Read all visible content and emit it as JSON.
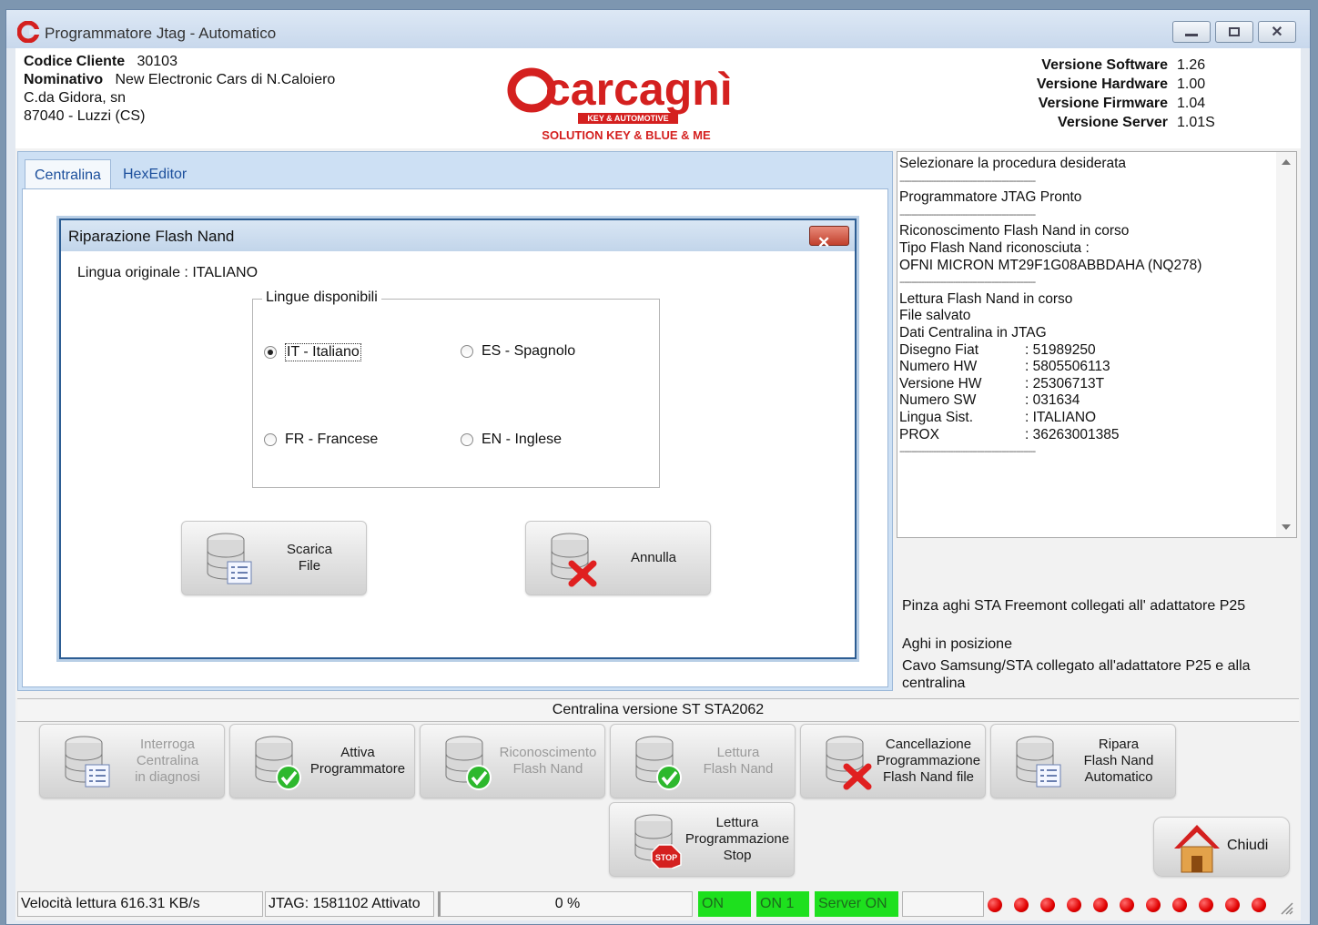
{
  "window": {
    "title": "Programmatore Jtag - Automatico"
  },
  "header": {
    "client_code_label": "Codice Cliente",
    "client_code": "30103",
    "name_label": "Nominativo",
    "name": "New Electronic Cars di N.Caloiero",
    "address1": "C.da Gidora, sn",
    "address2": "87040 - Luzzi (CS)",
    "logo_text": "carcagnì",
    "logo_tag": "KEY & AUTOMOTIVE",
    "logo_sub": "SOLUTION KEY & BLUE & ME",
    "versions": [
      {
        "label": "Versione Software",
        "value": "1.26"
      },
      {
        "label": "Versione Hardware",
        "value": "1.00"
      },
      {
        "label": "Versione Firmware",
        "value": "1.04"
      },
      {
        "label": "Versione Server",
        "value": "1.01S"
      }
    ]
  },
  "tabs": [
    {
      "label": "Centralina",
      "active": true
    },
    {
      "label": "HexEditor",
      "active": false
    }
  ],
  "dialog": {
    "title": "Riparazione Flash Nand",
    "close_label": "✕",
    "original_language": "Lingua originale : ITALIANO",
    "group_title": "Lingue disponibili",
    "options": [
      {
        "label": "IT - Italiano",
        "selected": true
      },
      {
        "label": "ES - Spagnolo",
        "selected": false
      },
      {
        "label": "FR - Francese",
        "selected": false
      },
      {
        "label": "EN - Inglese",
        "selected": false
      }
    ],
    "download_button": "Scarica\nFile",
    "cancel_button": "Annulla"
  },
  "log": {
    "lines": [
      {
        "text": "Selezionare la procedura desiderata"
      },
      {
        "sep": true
      },
      {
        "text": "Programmatore JTAG Pronto"
      },
      {
        "sep": true
      },
      {
        "text": "Riconoscimento Flash Nand in corso"
      },
      {
        "text": "Tipo Flash Nand riconosciuta :"
      },
      {
        "text": "OFNI MICRON MT29F1G08ABBDAHA (NQ278)"
      },
      {
        "sep": true
      },
      {
        "text": "Lettura Flash Nand in corso"
      },
      {
        "text": "File salvato"
      },
      {
        "text": "Dati Centralina in JTAG"
      },
      {
        "key": "Disegno Fiat",
        "val": ": 51989250"
      },
      {
        "key": "Numero HW",
        "val": ": 5805506113"
      },
      {
        "key": "Versione HW",
        "val": ": 25306713T"
      },
      {
        "key": "Numero SW",
        "val": ": 031634"
      },
      {
        "key": "Lingua Sist.",
        "val": ": ITALIANO"
      },
      {
        "key": "PROX",
        "val": ": 36263001385"
      },
      {
        "sep": true
      }
    ],
    "separator": "--------------------------------------------------------"
  },
  "messages": {
    "m1": "Pinza aghi STA Freemont collegati all' adattatore P25",
    "m2": "Aghi in posizione",
    "m3": "Cavo Samsung/STA collegato all'adattatore P25 e alla centralina"
  },
  "status_version": "Centralina versione ST STA2062",
  "actions": [
    {
      "label": "Interroga\nCentralina\nin diagnosi",
      "icon": "database-list-icon",
      "enabled": false
    },
    {
      "label": "Attiva\nProgrammatore",
      "icon": "database-check-icon",
      "enabled": true
    },
    {
      "label": "Riconoscimento\nFlash Nand",
      "icon": "database-check-icon",
      "enabled": false
    },
    {
      "label": "Lettura\nFlash Nand",
      "icon": "database-check-icon",
      "enabled": false
    },
    {
      "label": "Cancellazione\nProgrammazione\nFlash Nand file",
      "icon": "database-delete-icon",
      "enabled": true
    },
    {
      "label": "Ripara\nFlash Nand\nAutomatico",
      "icon": "database-list-icon",
      "enabled": true
    }
  ],
  "stop_button": "Lettura\nProgrammazione\nStop",
  "stop_badge": "STOP",
  "close_button": "Chiudi",
  "statusbar": {
    "speed": "Velocità lettura  616.31 KB/s",
    "jtag": "JTAG: 1581102 Attivato",
    "progress": "0 %",
    "on": "ON",
    "on1": "ON 1",
    "server": "Server ON",
    "led_count": 11,
    "led_color": "#e00000",
    "status_green": "#1ee01e"
  },
  "colors": {
    "brand_red": "#d4201f",
    "accent_blue": "#1c4f9c"
  }
}
